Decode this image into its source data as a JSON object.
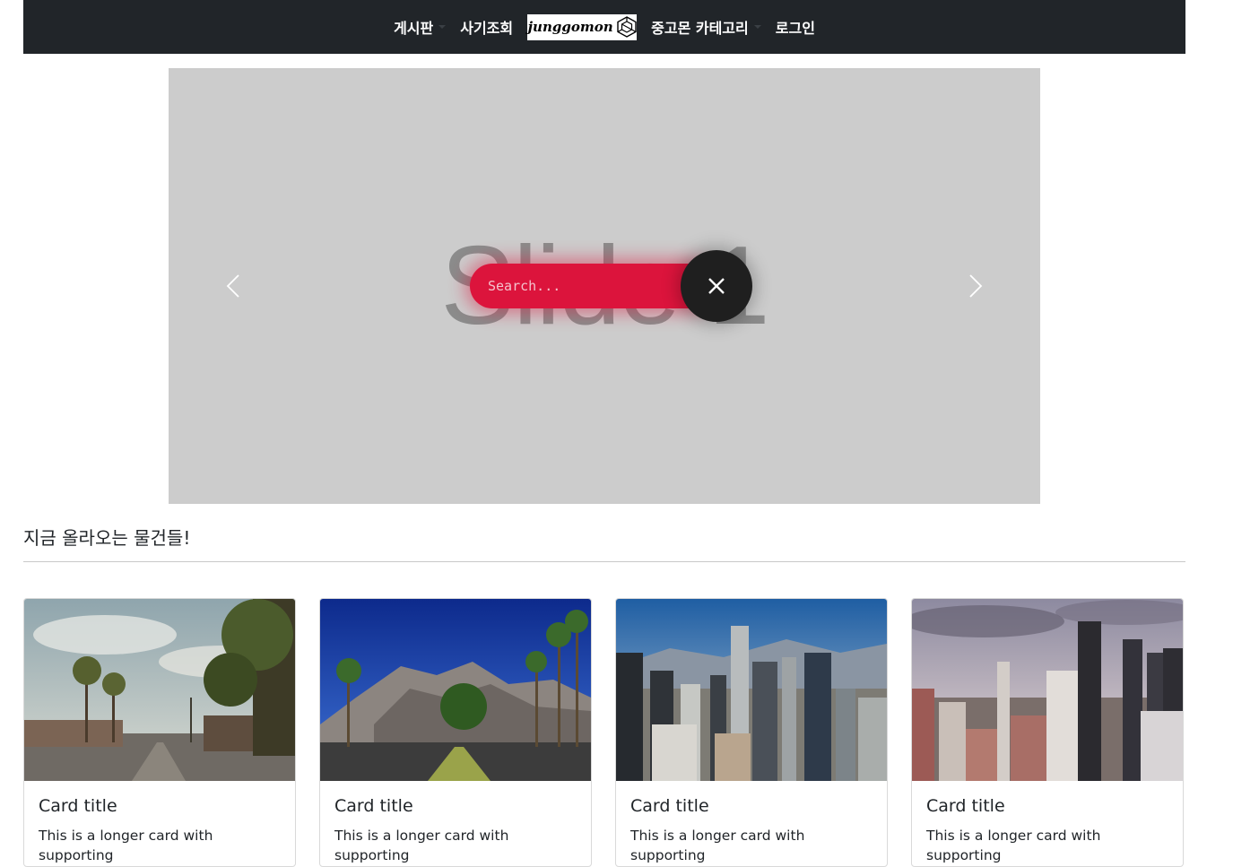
{
  "nav": {
    "board": "게시판",
    "fraud_check": "사기조회",
    "brand": "junggomon",
    "category": "중고몬 카테고리",
    "login": "로그인"
  },
  "carousel": {
    "slide_label": "Slide 1",
    "search_placeholder": "Search..."
  },
  "section": {
    "title": "지금 올라오는 물건들!"
  },
  "cards": [
    {
      "title": "Card title",
      "text": "This is a longer card with supporting"
    },
    {
      "title": "Card title",
      "text": "This is a longer card with supporting"
    },
    {
      "title": "Card title",
      "text": "This is a longer card with supporting"
    },
    {
      "title": "Card title",
      "text": "This is a longer card with supporting"
    }
  ],
  "colors": {
    "navbar_bg": "#212529",
    "search_accent": "#dc143c",
    "close_button": "#1f1f1f",
    "carousel_bg": "#cccccc"
  },
  "icons": [
    "caret-down-icon",
    "brand-logo-icon",
    "chevron-left-icon",
    "chevron-right-icon",
    "close-icon"
  ]
}
